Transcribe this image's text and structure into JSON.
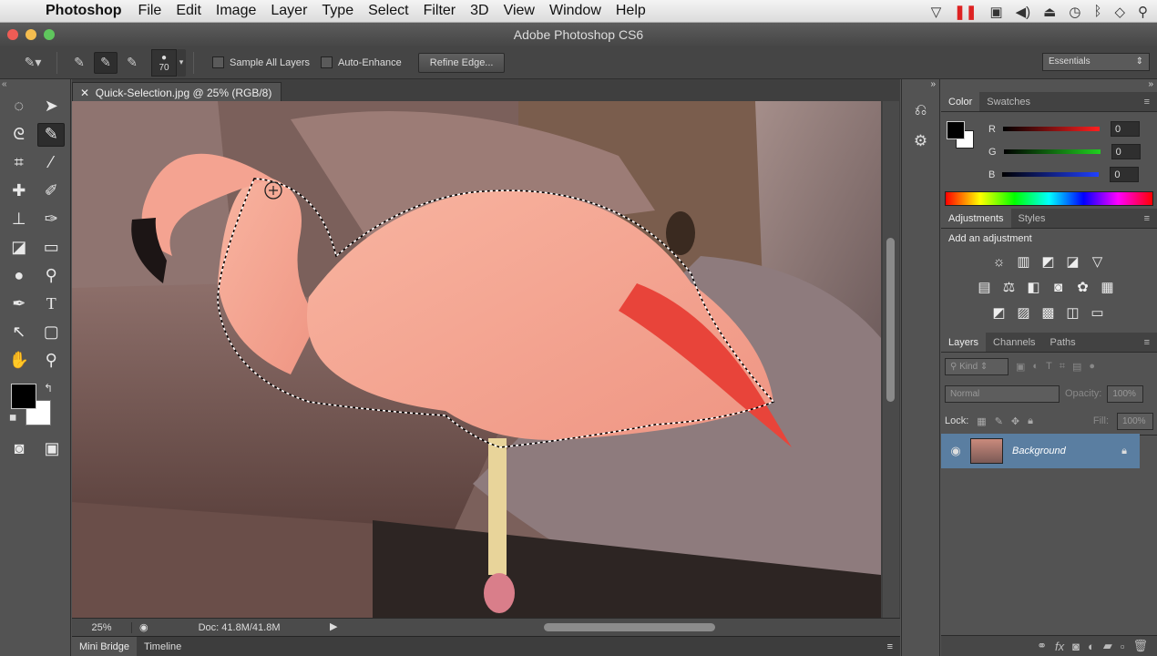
{
  "menubar": {
    "app": "Photoshop",
    "items": [
      "File",
      "Edit",
      "Image",
      "Layer",
      "Type",
      "Select",
      "Filter",
      "3D",
      "View",
      "Window",
      "Help"
    ]
  },
  "window": {
    "title": "Adobe Photoshop CS6"
  },
  "options": {
    "brush_size": "70",
    "sample_all_layers": "Sample All Layers",
    "auto_enhance": "Auto-Enhance",
    "refine_edge": "Refine Edge...",
    "workspace": "Essentials"
  },
  "document": {
    "tab_title": "Quick-Selection.jpg @ 25% (RGB/8)",
    "zoom": "25%",
    "doc_size": "Doc: 41.8M/41.8M"
  },
  "bottom_tabs": [
    "Mini Bridge",
    "Timeline"
  ],
  "color_panel": {
    "tabs": [
      "Color",
      "Swatches"
    ],
    "channels": [
      {
        "label": "R",
        "value": "0",
        "color": "#ff2020"
      },
      {
        "label": "G",
        "value": "0",
        "color": "#20d020"
      },
      {
        "label": "B",
        "value": "0",
        "color": "#2040ff"
      }
    ]
  },
  "adjustments_panel": {
    "tabs": [
      "Adjustments",
      "Styles"
    ],
    "heading": "Add an adjustment"
  },
  "layers_panel": {
    "tabs": [
      "Layers",
      "Channels",
      "Paths"
    ],
    "kind": "Kind",
    "blend_mode": "Normal",
    "opacity_label": "Opacity:",
    "opacity": "100%",
    "lock_label": "Lock:",
    "fill_label": "Fill:",
    "fill": "100%",
    "layer_name": "Background"
  },
  "colors": {
    "accent": "#5a7ea1",
    "flamingo": "#f2a28f"
  }
}
